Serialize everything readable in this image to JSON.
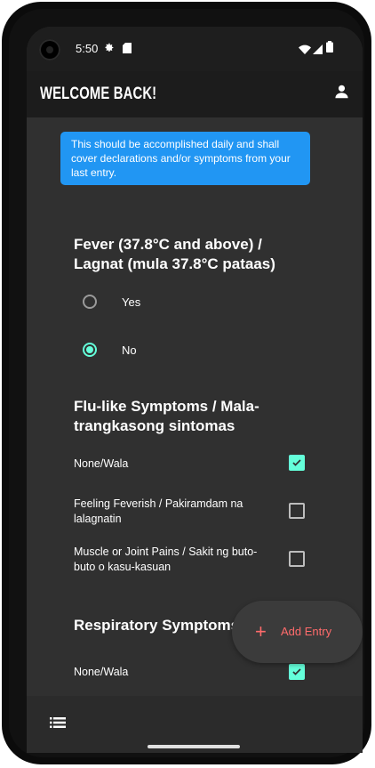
{
  "status_bar": {
    "time": "5:50"
  },
  "app_bar": {
    "title": "WELCOME BACK!"
  },
  "notice": {
    "text": "This should be accomplished daily and shall cover declarations and/or symptoms from your last entry."
  },
  "fever": {
    "title": "Fever (37.8°C and above) / Lagnat (mula 37.8°C pataas)",
    "options": [
      {
        "label": "Yes",
        "selected": false
      },
      {
        "label": "No",
        "selected": true
      }
    ]
  },
  "flu": {
    "title": "Flu-like Symptoms / Mala-trangkasong sintomas",
    "items": [
      {
        "label": "None/Wala",
        "checked": true
      },
      {
        "label": "Feeling Feverish / Pakiramdam na lalagnatin",
        "checked": false
      },
      {
        "label": "Muscle or Joint Pains / Sakit ng buto-buto o kasu-kasuan",
        "checked": false
      }
    ]
  },
  "respiratory": {
    "title": "Respiratory Symptoms",
    "items": [
      {
        "label": "None/Wala",
        "checked": true
      }
    ]
  },
  "fab": {
    "label": "Add Entry"
  },
  "colors": {
    "accent": "#64ffda",
    "notice": "#2196f3",
    "fab_text": "#ff6b6b",
    "background": "#303030"
  },
  "icons": {
    "profile": "account-icon",
    "list": "list-icon",
    "add": "plus-icon"
  }
}
